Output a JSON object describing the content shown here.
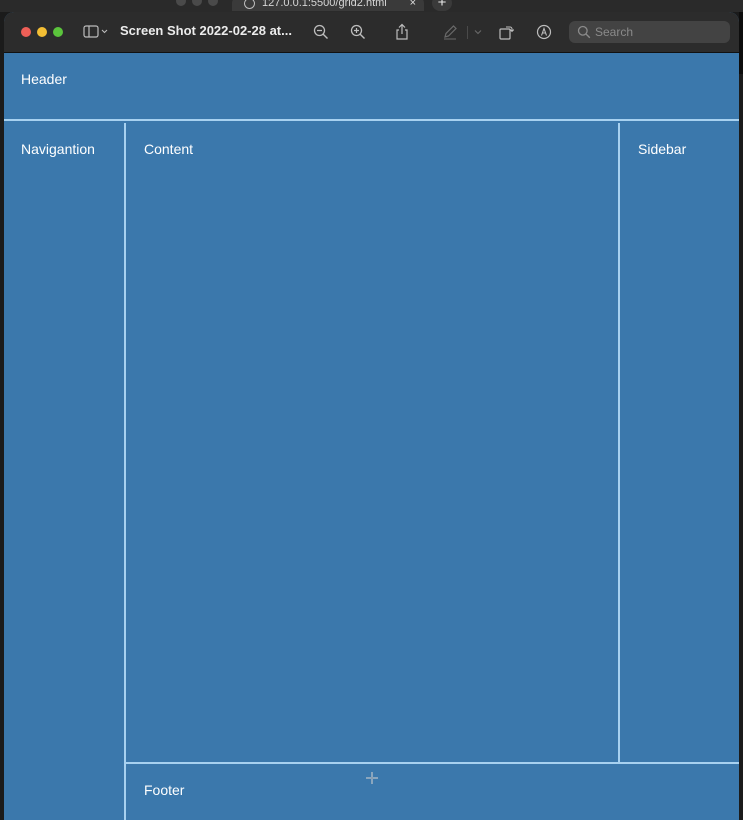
{
  "background_tab": {
    "url": "127.0.0.1:5500/grid2.html",
    "close_glyph": "×",
    "new_tab_glyph": "+"
  },
  "window": {
    "title": "Screen Shot 2022-02-28 at...",
    "toolbar": {
      "icons": [
        "sidebar-toggle-icon",
        "zoom-out-icon",
        "zoom-in-icon",
        "share-icon",
        "markup-pen-icon",
        "rotate-icon",
        "annotate-icon"
      ]
    },
    "search": {
      "placeholder": "Search",
      "value": ""
    }
  },
  "document": {
    "header": "Header",
    "navigation": "Navigantion",
    "content": "Content",
    "sidebar": "Sidebar",
    "footer": "Footer"
  },
  "colors": {
    "cell_background": "#3b78ac",
    "grid_line": "#a7d1f0",
    "titlebar": "#2c2c2c"
  }
}
